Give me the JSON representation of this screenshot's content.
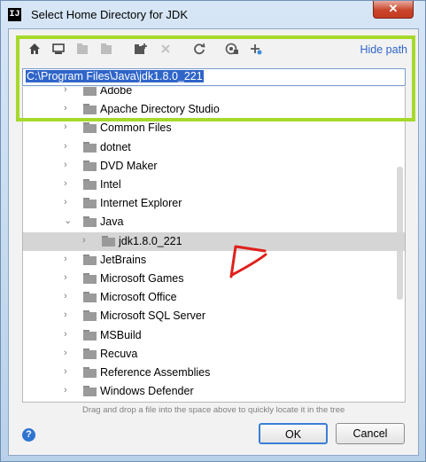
{
  "window": {
    "title": "Select Home Directory for JDK",
    "app_icon_text": "IJ",
    "close_glyph": "✕"
  },
  "toolbar": {
    "icons": [
      "home-icon",
      "desktop-icon",
      "project-icon",
      "module-icon",
      "new-folder-icon",
      "delete-icon",
      "refresh-icon",
      "show-hidden-icon",
      "collapse-icon"
    ],
    "hide_path_label": "Hide path"
  },
  "path_field": {
    "value": "C:\\Program Files\\Java\\jdk1.8.0_221"
  },
  "tree": {
    "items": [
      {
        "label": "Adobe",
        "level": 0,
        "expanded": false
      },
      {
        "label": "Apache Directory Studio",
        "level": 0,
        "expanded": false
      },
      {
        "label": "Common Files",
        "level": 0,
        "expanded": false
      },
      {
        "label": "dotnet",
        "level": 0,
        "expanded": false
      },
      {
        "label": "DVD Maker",
        "level": 0,
        "expanded": false
      },
      {
        "label": "Intel",
        "level": 0,
        "expanded": false
      },
      {
        "label": "Internet Explorer",
        "level": 0,
        "expanded": false
      },
      {
        "label": "Java",
        "level": 0,
        "expanded": true
      },
      {
        "label": "jdk1.8.0_221",
        "level": 1,
        "expanded": false,
        "selected": true
      },
      {
        "label": "JetBrains",
        "level": 0,
        "expanded": false
      },
      {
        "label": "Microsoft Games",
        "level": 0,
        "expanded": false
      },
      {
        "label": "Microsoft Office",
        "level": 0,
        "expanded": false
      },
      {
        "label": "Microsoft SQL Server",
        "level": 0,
        "expanded": false
      },
      {
        "label": "MSBuild",
        "level": 0,
        "expanded": false
      },
      {
        "label": "Recuva",
        "level": 0,
        "expanded": false
      },
      {
        "label": "Reference Assemblies",
        "level": 0,
        "expanded": false
      },
      {
        "label": "Windows Defender",
        "level": 0,
        "expanded": false
      }
    ]
  },
  "hint_text": "Drag and drop a file into the space above to quickly locate it in the tree",
  "buttons": {
    "ok": "OK",
    "cancel": "Cancel",
    "help": "?"
  },
  "colors": {
    "annotation_box": "#a6d92b",
    "annotation_arrow": "#e0201b",
    "link": "#2f65c9"
  }
}
